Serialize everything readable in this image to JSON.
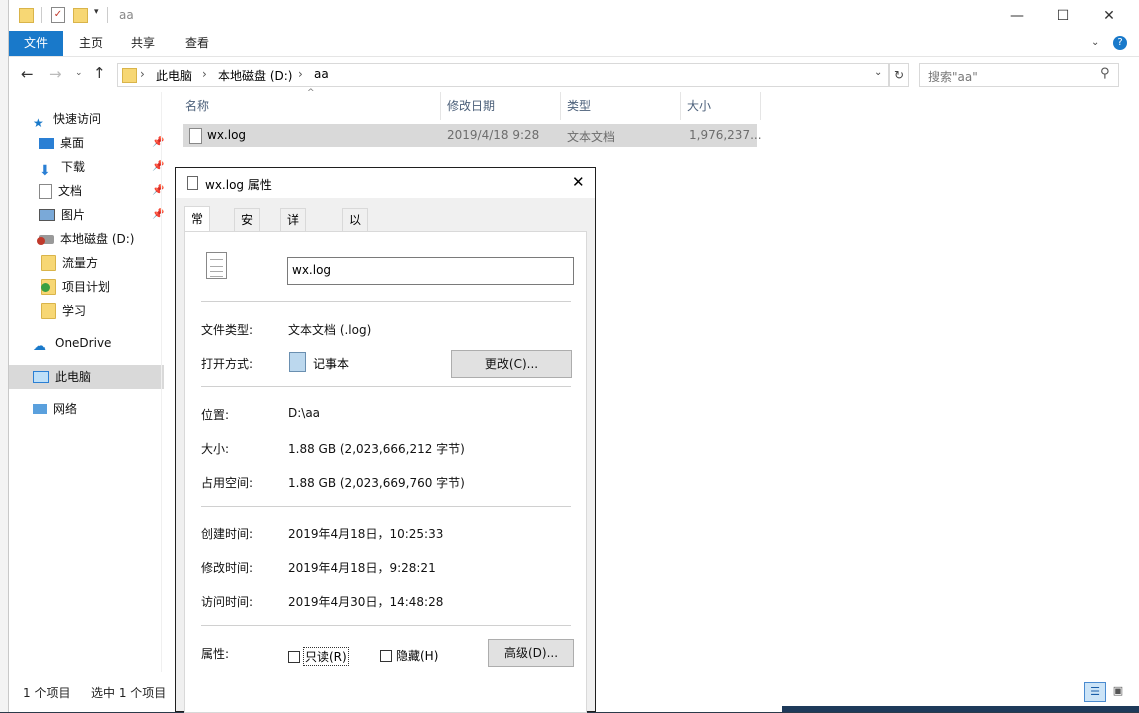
{
  "window": {
    "title": "aa",
    "minimize": "—",
    "maximize": "☐",
    "close": "✕"
  },
  "ribbon": {
    "tabs": [
      "文件",
      "主页",
      "共享",
      "查看"
    ]
  },
  "address": {
    "crumbs": [
      "此电脑",
      "本地磁盘 (D:)",
      "aa"
    ],
    "search_placeholder": "搜索\"aa\""
  },
  "sidebar": {
    "items": [
      {
        "label": "快速访问",
        "icon": "star-icon"
      },
      {
        "label": "桌面",
        "icon": "desktop-icon",
        "pinned": true
      },
      {
        "label": "下载",
        "icon": "download-icon",
        "pinned": true
      },
      {
        "label": "文档",
        "icon": "document-icon",
        "pinned": true
      },
      {
        "label": "图片",
        "icon": "picture-icon",
        "pinned": true
      },
      {
        "label": "本地磁盘 (D:)",
        "icon": "drive-icon"
      },
      {
        "label": "流量方",
        "icon": "folder-icon"
      },
      {
        "label": "项目计划",
        "icon": "folder-check-icon"
      },
      {
        "label": "学习",
        "icon": "folder-icon"
      },
      {
        "label": "OneDrive",
        "icon": "cloud-icon"
      },
      {
        "label": "此电脑",
        "icon": "computer-icon",
        "selected": true
      },
      {
        "label": "网络",
        "icon": "network-icon"
      }
    ]
  },
  "filelist": {
    "columns": [
      "名称",
      "修改日期",
      "类型",
      "大小"
    ],
    "rows": [
      {
        "name": "wx.log",
        "modified": "2019/4/18 9:28",
        "type": "文本文档",
        "size": "1,976,237..."
      }
    ]
  },
  "status": {
    "count": "1 个项目",
    "selected": "选中 1 个项目"
  },
  "dialog": {
    "title": "wx.log 属性",
    "tabs": [
      "常规",
      "安全",
      "详细信息",
      "以前的版本"
    ],
    "filename": "wx.log",
    "type_label": "文件类型:",
    "type_value": "文本文档 (.log)",
    "open_label": "打开方式:",
    "open_value": "记事本",
    "change_button": "更改(C)...",
    "location_label": "位置:",
    "location_value": "D:\\aa",
    "size_label": "大小:",
    "size_value": "1.88 GB (2,023,666,212 字节)",
    "disk_label": "占用空间:",
    "disk_value": "1.88 GB (2,023,669,760 字节)",
    "created_label": "创建时间:",
    "created_value": "2019年4月18日，10:25:33",
    "modified_label": "修改时间:",
    "modified_value": "2019年4月18日，9:28:21",
    "accessed_label": "访问时间:",
    "accessed_value": "2019年4月30日，14:48:28",
    "attr_label": "属性:",
    "readonly_label": "只读(R)",
    "hidden_label": "隐藏(H)",
    "advanced_button": "高级(D)..."
  }
}
